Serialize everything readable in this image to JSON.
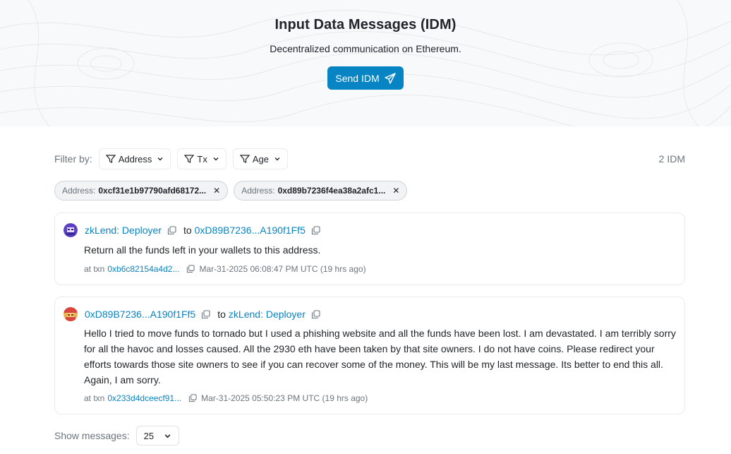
{
  "header": {
    "title": "Input Data Messages (IDM)",
    "subtitle": "Decentralized communication on Ethereum.",
    "send_button": "Send IDM",
    "send_icon": "paper-plane-icon"
  },
  "filters": {
    "label": "Filter by:",
    "buttons": [
      "Address",
      "Tx",
      "Age"
    ],
    "count": "2 IDM",
    "chips": [
      {
        "label": "Address:",
        "value": "0xcf31e1b97790afd68172..."
      },
      {
        "label": "Address:",
        "value": "0xd89b7236f4ea38a2afc1..."
      }
    ]
  },
  "messages": [
    {
      "from": "zkLend: Deployer",
      "to_word": "to",
      "to": "0xD89B7236...A190f1Ff5",
      "text": "Return all the funds left in your wallets to this address.",
      "txn_prefix": "at txn",
      "txn": "0xb6c82154a4d2...",
      "timestamp": "Mar-31-2025 06:08:47 PM UTC (19 hrs ago)"
    },
    {
      "from": "0xD89B7236...A190f1Ff5",
      "to_word": "to",
      "to": "zkLend: Deployer",
      "text": "Hello I tried to move funds to tornado but I used a phishing website and all the funds have been lost. I am devastated. I am terribly sorry for all the havoc and losses caused. All the 2930 eth have been taken by that site owners. I do not have coins. Please redirect your efforts towards those site owners to see if you can recover some of the money. This will be my last message. Its better to end this all. Again, I am sorry.",
      "txn_prefix": "at txn",
      "txn": "0x233d4dceecf91...",
      "timestamp": "Mar-31-2025 05:50:23 PM UTC (19 hrs ago)"
    }
  ],
  "footer": {
    "show_label": "Show messages:",
    "page_size": "25"
  },
  "colors": {
    "accent": "#0784c3",
    "muted": "#6c757d",
    "border": "#e9ecef"
  }
}
